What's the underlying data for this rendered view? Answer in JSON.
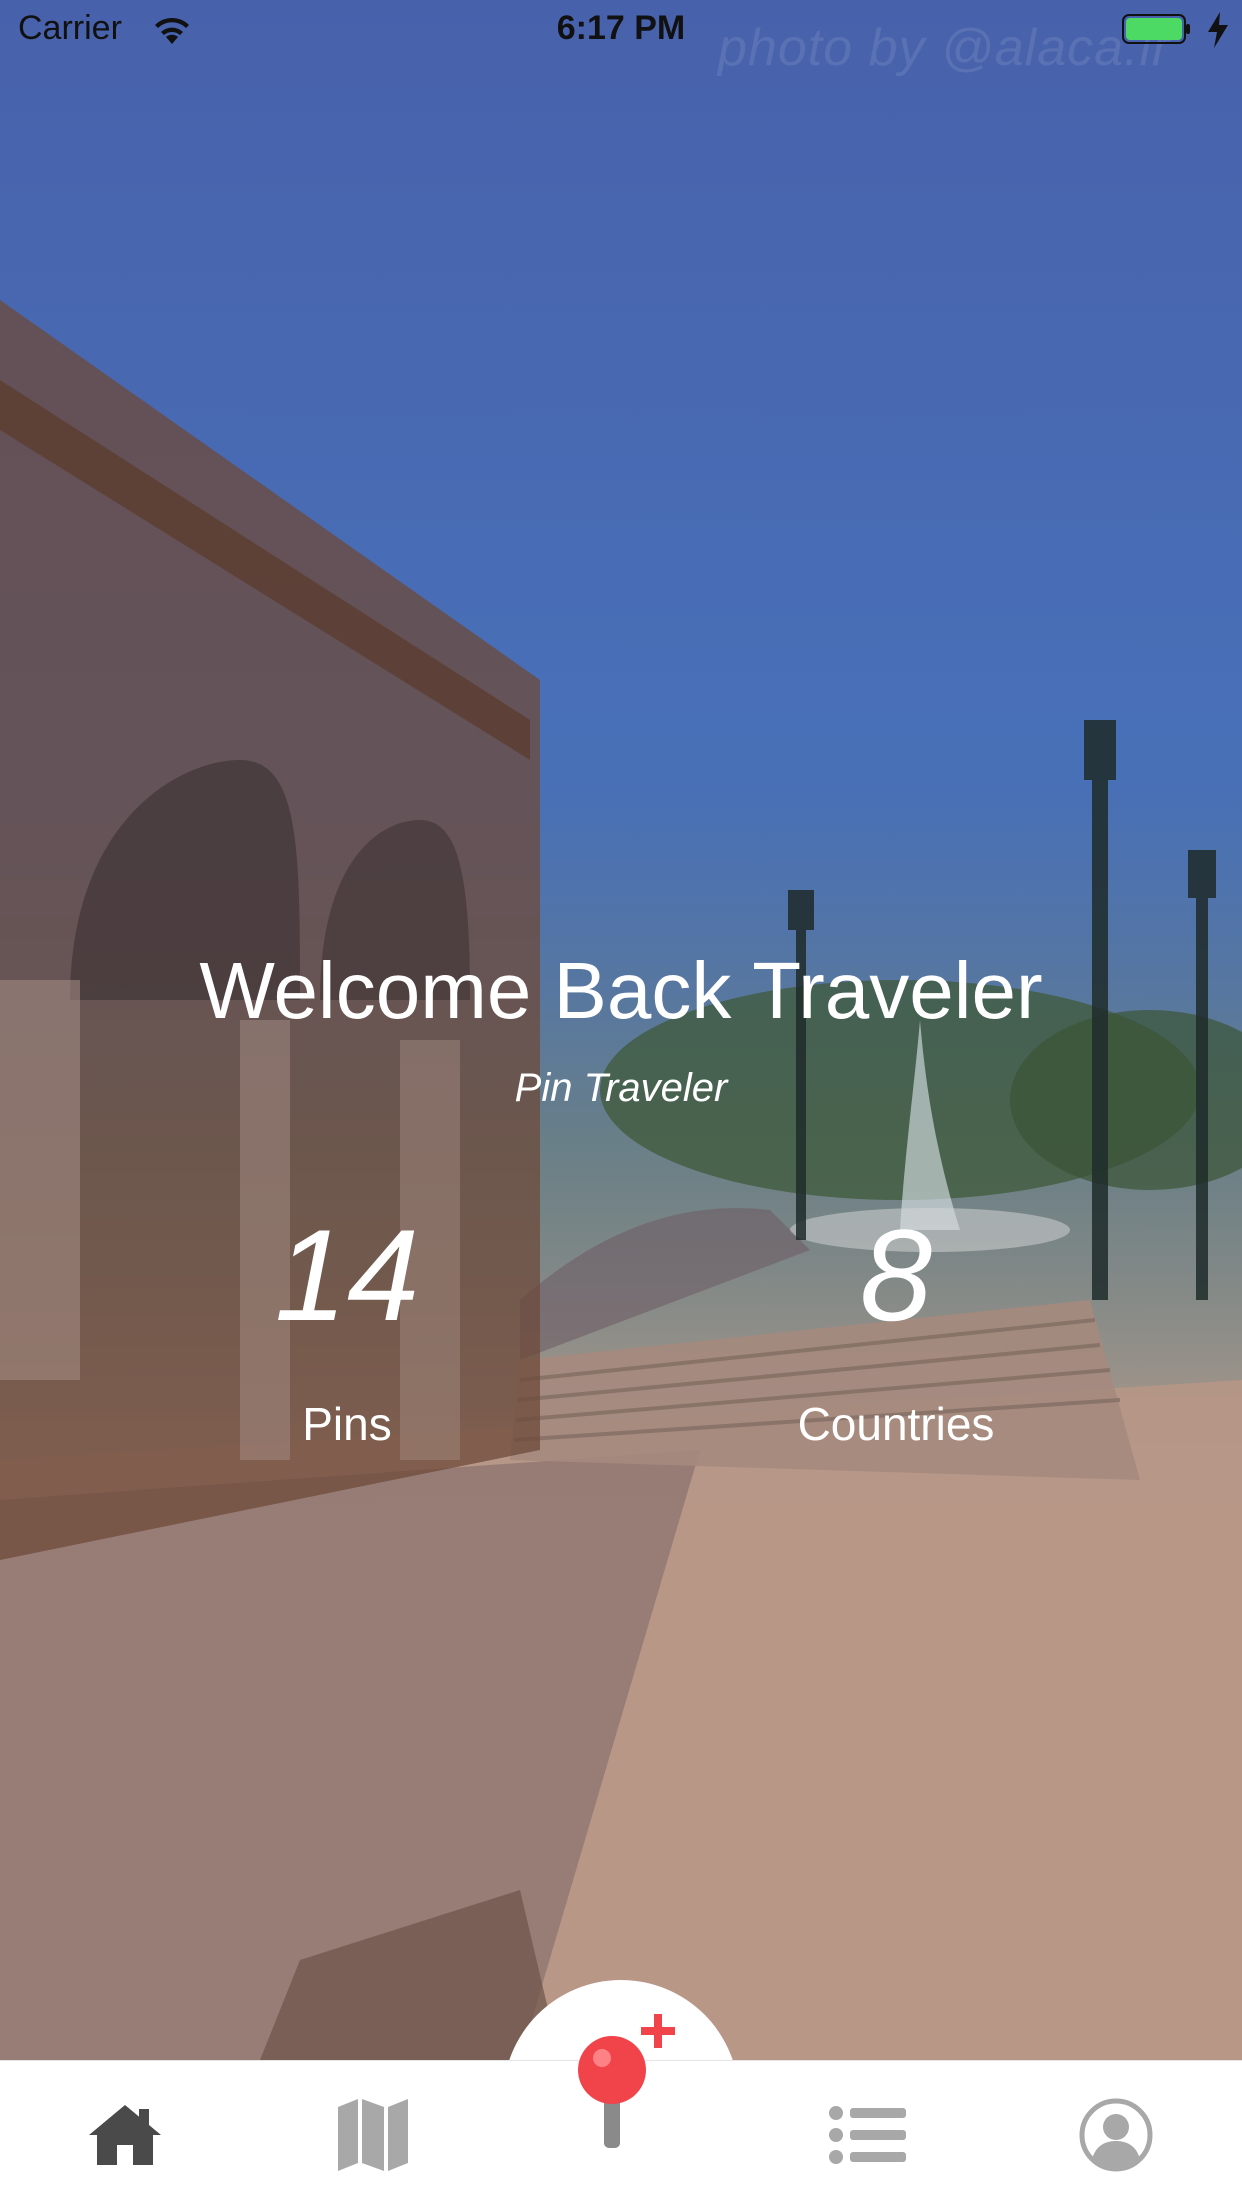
{
  "status_bar": {
    "carrier": "Carrier",
    "time": "6:17 PM",
    "battery_color": "#4cd964"
  },
  "background": {
    "credit": "photo by @alaca.ir"
  },
  "welcome": {
    "title": "Welcome Back Traveler",
    "subtitle": "Pin Traveler"
  },
  "stats": {
    "pins": {
      "value": "14",
      "label": "Pins"
    },
    "countries": {
      "value": "8",
      "label": "Countries"
    }
  },
  "tab_bar": {
    "items": [
      {
        "name": "home",
        "icon": "home-icon",
        "active": true
      },
      {
        "name": "map",
        "icon": "map-icon",
        "active": false
      },
      {
        "name": "add-pin",
        "icon": "add-pin-icon",
        "active": false
      },
      {
        "name": "list",
        "icon": "list-icon",
        "active": false
      },
      {
        "name": "profile",
        "icon": "profile-icon",
        "active": false
      }
    ],
    "active_color": "#4a4a4a",
    "inactive_color": "#a8a8a8",
    "accent_color": "#f0444a"
  }
}
